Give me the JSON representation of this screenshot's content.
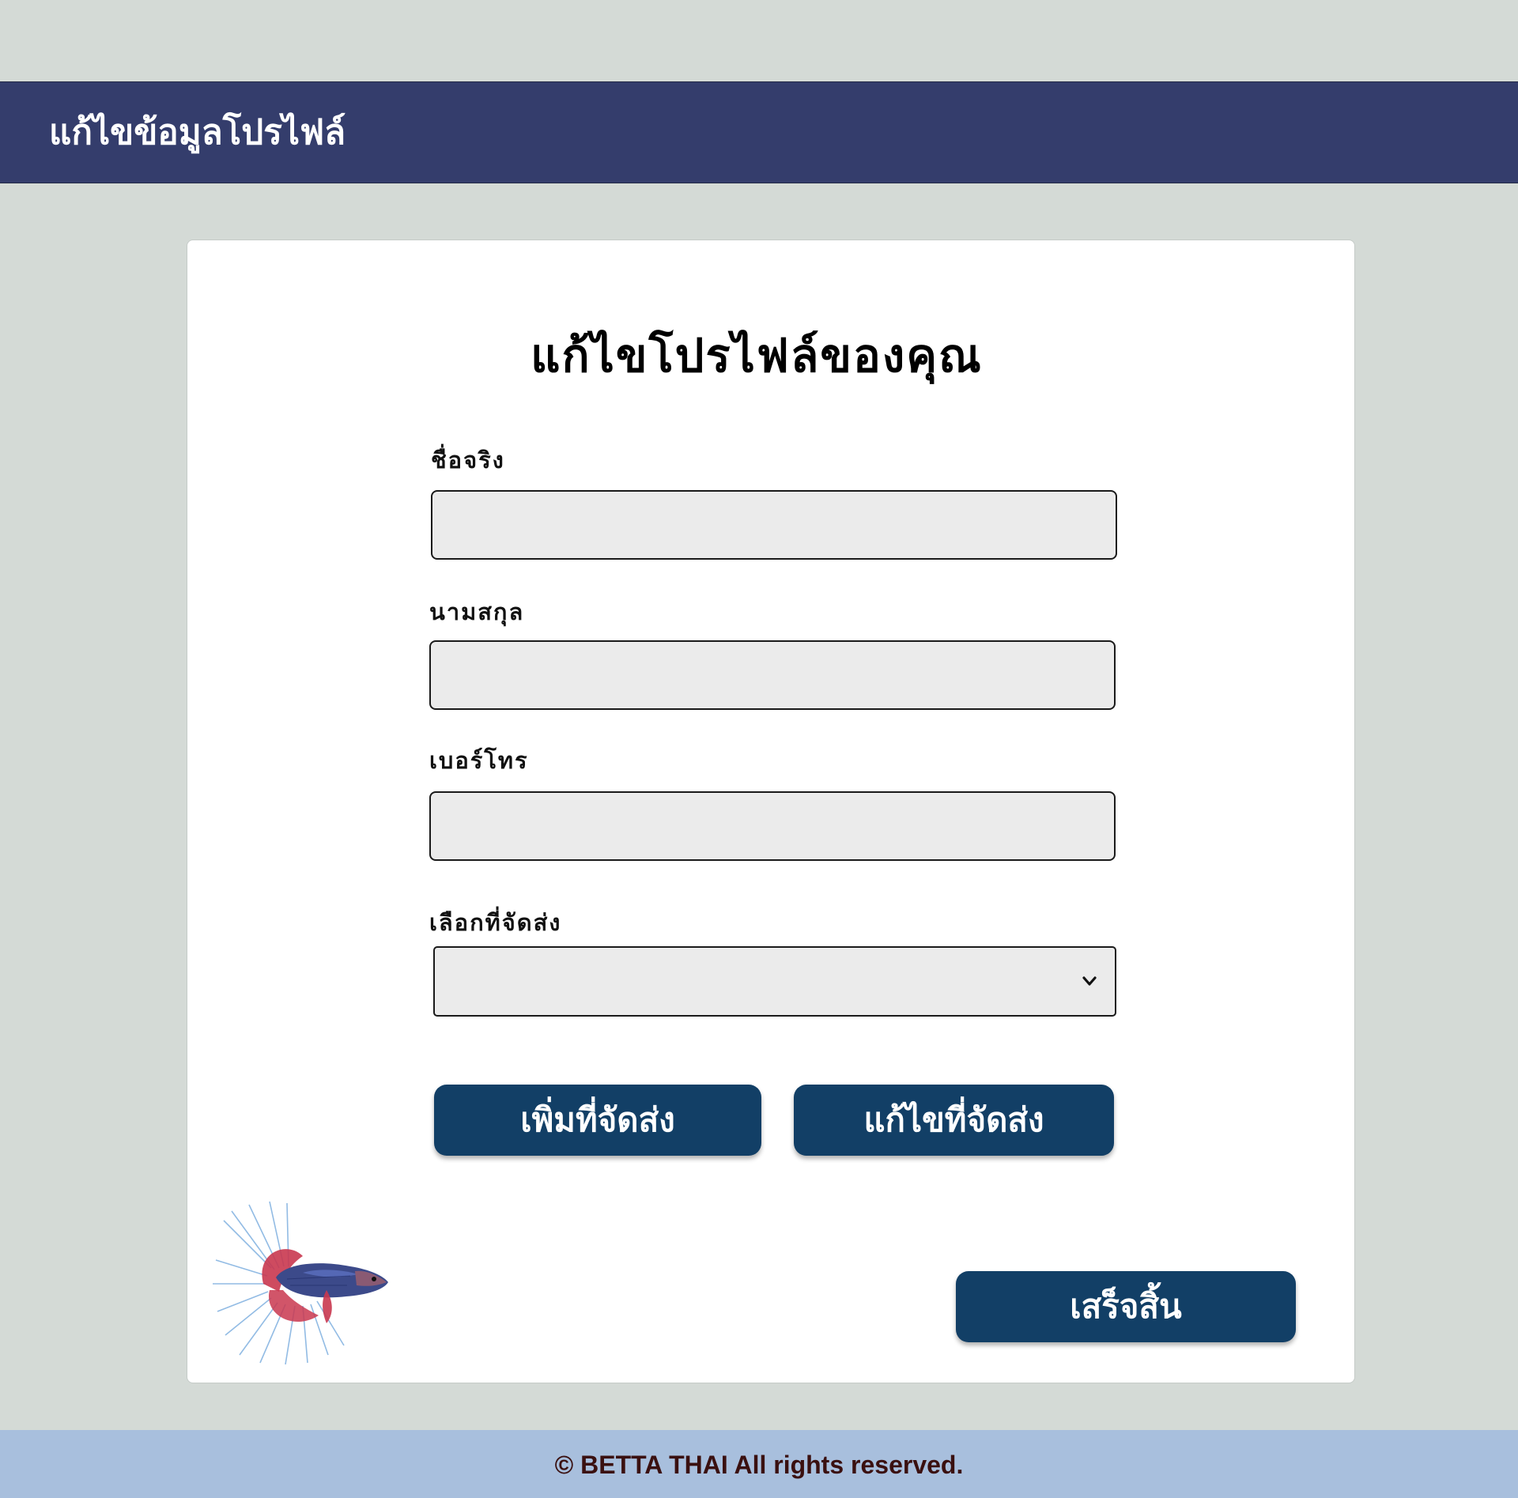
{
  "header": {
    "title": "แก้ไขข้อมูลโปรไฟล์"
  },
  "form": {
    "title": "แก้ไขโปรไฟล์ของคุณ",
    "first_name": {
      "label": "ชื่อจริง",
      "value": "",
      "placeholder": ""
    },
    "last_name": {
      "label": "นามสกุล",
      "value": "",
      "placeholder": ""
    },
    "phone": {
      "label": "เบอร์โทร",
      "value": "",
      "placeholder": ""
    },
    "shipping": {
      "label": "เลือกที่จัดส่ง",
      "selected": ""
    },
    "add_address_label": "เพิ่มที่จัดส่ง",
    "edit_address_label": "แก้ไขที่จัดส่ง",
    "finish_label": "เสร็จสิ้น"
  },
  "footer": {
    "text": "© BETTA THAI All rights reserved."
  },
  "colors": {
    "background": "#d4dad6",
    "header": "#343d6c",
    "button": "#123f66",
    "input_bg": "#ebebeb",
    "footer": "#a8bfdd",
    "footer_text": "#3a1010"
  },
  "icons": {
    "select_arrow": "chevron-down-icon",
    "logo": "betta-fish-image"
  }
}
